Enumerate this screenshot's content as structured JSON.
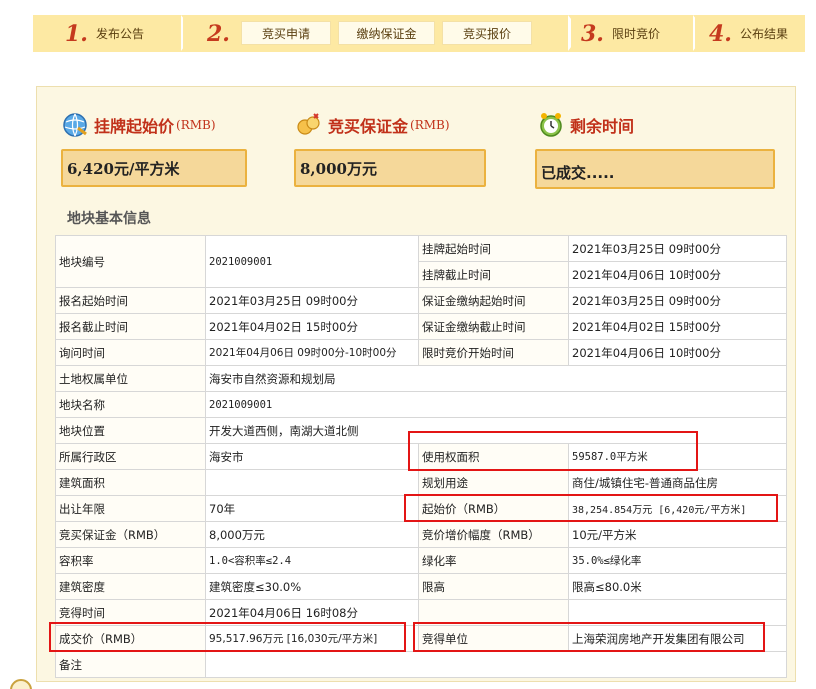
{
  "steps": {
    "s1_num": "1.",
    "s1_label": "发布公告",
    "s2_num": "2.",
    "s2_sub1": "竞买申请",
    "s2_sub2": "缴纳保证金",
    "s2_sub3": "竞买报价",
    "s3_num": "3.",
    "s3_label": "限时竞价",
    "s4_num": "4.",
    "s4_label": "公布结果"
  },
  "stats": {
    "start_price_title": "挂牌起始价",
    "start_price_unit": "(RMB)",
    "start_price_value": "6,420元/平方米",
    "deposit_title": "竞买保证金",
    "deposit_unit": "(RMB)",
    "deposit_value": "8,000万元",
    "remaining_title": "剩余时间",
    "remaining_value": "已成交....."
  },
  "section_title": "地块基本信息",
  "table": {
    "r1": {
      "l1": "地块编号",
      "v1": "2021009001",
      "l2": "挂牌起始时间",
      "v2": "2021年03月25日 09时00分"
    },
    "r1b": {
      "l2": "挂牌截止时间",
      "v2": "2021年04月06日 10时00分"
    },
    "r2": {
      "l1": "报名起始时间",
      "v1": "2021年03月25日 09时00分",
      "l2": "保证金缴纳起始时间",
      "v2": "2021年03月25日 09时00分"
    },
    "r3": {
      "l1": "报名截止时间",
      "v1": "2021年04月02日 15时00分",
      "l2": "保证金缴纳截止时间",
      "v2": "2021年04月02日 15时00分"
    },
    "r4": {
      "l1": "询问时间",
      "v1": "2021年04月06日 09时00分-10时00分",
      "l2": "限时竞价开始时间",
      "v2": "2021年04月06日 10时00分"
    },
    "r5": {
      "l1": "土地权属单位",
      "v1": "海安市自然资源和规划局"
    },
    "r6": {
      "l1": "地块名称",
      "v1": "2021009001"
    },
    "r7": {
      "l1": "地块位置",
      "v1": "开发大道西侧，南湖大道北侧"
    },
    "r8": {
      "l1": "所属行政区",
      "v1": "海安市",
      "l2": "使用权面积",
      "v2": "59587.0平方米"
    },
    "r9": {
      "l1": "建筑面积",
      "v1": "",
      "l2": "规划用途",
      "v2": "商住/城镇住宅-普通商品住房"
    },
    "r10": {
      "l1": "出让年限",
      "v1": "70年",
      "l2": "起始价（RMB）",
      "v2": "38,254.854万元 [6,420元/平方米]"
    },
    "r11": {
      "l1": "竞买保证金（RMB）",
      "v1": "8,000万元",
      "l2": "竞价增价幅度（RMB）",
      "v2": "10元/平方米"
    },
    "r12": {
      "l1": "容积率",
      "v1": "1.0<容积率≤2.4",
      "l2": "绿化率",
      "v2": "35.0%≤绿化率"
    },
    "r13": {
      "l1": "建筑密度",
      "v1": "建筑密度≤30.0%",
      "l2": "限高",
      "v2": "限高≤80.0米"
    },
    "r14": {
      "l1": "竞得时间",
      "v1": "2021年04月06日 16时08分",
      "l2": "",
      "v2": ""
    },
    "r15": {
      "l1": "成交价（RMB）",
      "v1": "95,517.96万元 [16,030元/平方米]",
      "l2": "竞得单位",
      "v2": "上海荣润房地产开发集团有限公司"
    },
    "r16": {
      "l1": "备注",
      "v1": ""
    }
  },
  "colors": {
    "step_bg": "#fde9a3",
    "accent_red": "#c1311a",
    "stat_box_bg": "#f5d89a",
    "stat_box_border": "#ebb23f",
    "highlight_border": "#e31515"
  }
}
